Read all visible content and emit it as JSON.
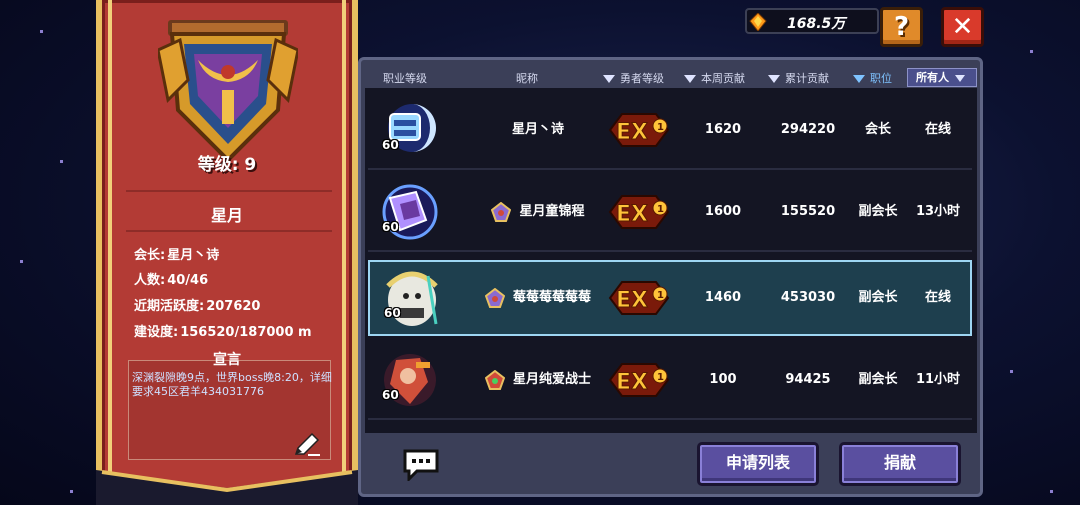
{
  "currency": {
    "icon": "gem-icon",
    "value": "168.5万"
  },
  "buttons": {
    "help": "?",
    "close": "✕",
    "apply_list": "申请列表",
    "donate": "捐献"
  },
  "guild": {
    "level_text": "等级: 9",
    "name": "星月",
    "leader_label": "会长:",
    "leader": "星月丶诗",
    "members_label": "人数:",
    "members": "40/46",
    "activity_label": "近期活跃度:",
    "activity": "207620",
    "construction_label": "建设度:",
    "construction": "156520/187000 m",
    "declaration_title": "宣言",
    "declaration": "深渊裂隙晚9点，世界boss晚8:20，详细要求45区君羊434031776"
  },
  "table": {
    "headers": {
      "class_level": "职业等级",
      "nickname": "昵称",
      "hero_level": "勇者等级",
      "weekly": "本周贡献",
      "total": "累计贡献",
      "position": "职位"
    },
    "filter": "所有人",
    "rows": [
      {
        "level": "60",
        "nickname": "星月丶诗",
        "rank": "EX",
        "rank_num": "1",
        "weekly": "1620",
        "total": "294220",
        "position": "会长",
        "status": "在线",
        "selected": false
      },
      {
        "level": "60",
        "nickname": "星月童锦程",
        "rank": "EX",
        "rank_num": "1",
        "weekly": "1600",
        "total": "155520",
        "position": "副会长",
        "status": "13小时",
        "selected": false
      },
      {
        "level": "60",
        "nickname": "莓莓莓莓莓莓",
        "rank": "EX",
        "rank_num": "1",
        "weekly": "1460",
        "total": "453030",
        "position": "副会长",
        "status": "在线",
        "selected": true
      },
      {
        "level": "60",
        "nickname": "星月纯爱战士",
        "rank": "EX",
        "rank_num": "1",
        "weekly": "100",
        "total": "94425",
        "position": "副会长",
        "status": "11小时",
        "selected": false
      }
    ]
  },
  "colors": {
    "banner": "#b33b35",
    "gold": "#e8c060",
    "selected_row": "#1e3f4e",
    "accent_blue": "#7fc3ff"
  }
}
